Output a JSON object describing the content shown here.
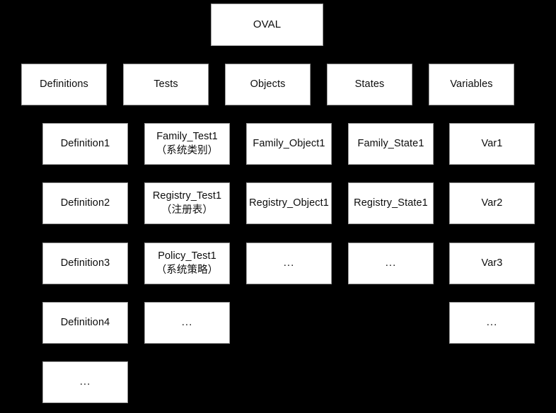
{
  "diagram": {
    "title": "OVAL",
    "background_color": "#000000",
    "node_fill_color": "#ffffff",
    "node_border_color": "#9a9a9a",
    "node_text_color": "#0d0d0d",
    "root": {
      "label": "OVAL"
    },
    "categories": [
      {
        "label": "Definitions"
      },
      {
        "label": "Tests"
      },
      {
        "label": "Objects"
      },
      {
        "label": "States"
      },
      {
        "label": "Variables"
      }
    ],
    "columns": [
      {
        "name": "definitions",
        "items": [
          {
            "line1": "Definition1",
            "line2": ""
          },
          {
            "line1": "Definition2",
            "line2": ""
          },
          {
            "line1": "Definition3",
            "line2": ""
          },
          {
            "line1": "Definition4",
            "line2": ""
          },
          {
            "line1": "...",
            "line2": ""
          }
        ]
      },
      {
        "name": "tests",
        "items": [
          {
            "line1": "Family_Test1",
            "line2": "（系统类别）"
          },
          {
            "line1": "Registry_Test1",
            "line2": "（注册表）"
          },
          {
            "line1": "Policy_Test1",
            "line2": "（系统策略）"
          },
          {
            "line1": "...",
            "line2": ""
          }
        ]
      },
      {
        "name": "objects",
        "items": [
          {
            "line1": "Family_Object1",
            "line2": ""
          },
          {
            "line1": "Registry_Object1",
            "line2": ""
          },
          {
            "line1": "...",
            "line2": ""
          }
        ]
      },
      {
        "name": "states",
        "items": [
          {
            "line1": "Family_State1",
            "line2": ""
          },
          {
            "line1": "Registry_State1",
            "line2": ""
          },
          {
            "line1": "...",
            "line2": ""
          }
        ]
      },
      {
        "name": "variables",
        "items": [
          {
            "line1": "Var1",
            "line2": ""
          },
          {
            "line1": "Var2",
            "line2": ""
          },
          {
            "line1": "Var3",
            "line2": ""
          },
          {
            "line1": "...",
            "line2": ""
          }
        ]
      }
    ]
  }
}
